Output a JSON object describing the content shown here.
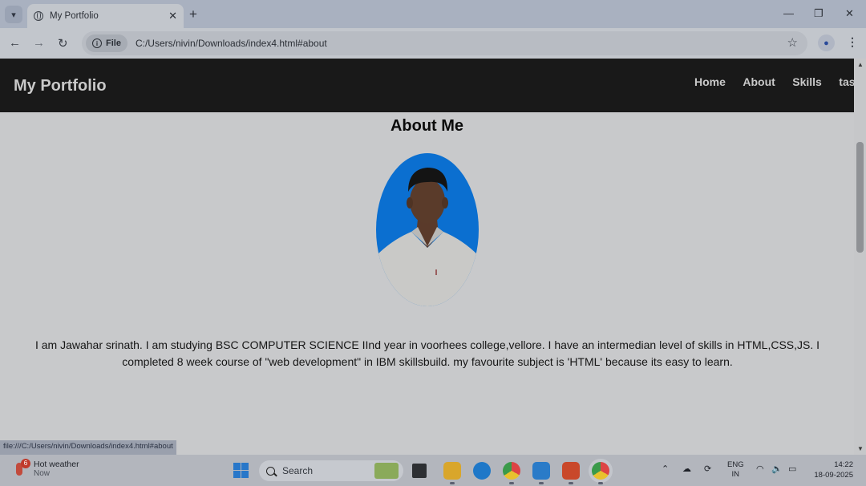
{
  "browser": {
    "tab_title": "My Portfolio",
    "new_tab": "+",
    "site_info_chip": "File",
    "url": "C:/Users/nivin/Downloads/index4.html#about",
    "status_url": "file:///C:/Users/nivin/Downloads/index4.html#about"
  },
  "site": {
    "brand": "My Portfolio",
    "nav": [
      "Home",
      "About",
      "Skills",
      "task"
    ],
    "about_heading": "About Me",
    "about_text": "I am Jawahar srinath. I am studying BSC COMPUTER SCIENCE IInd year in voorhees college,vellore. I have an intermedian level of skills in HTML,CSS,JS. I completed 8 week course of \"web development\" in IBM skillsbuild. my favourite subject is 'HTML' because its easy to learn."
  },
  "taskbar": {
    "weather_title": "Hot weather",
    "weather_sub": "Now",
    "weather_badge": "6",
    "search_label": "Search",
    "lang_top": "ENG",
    "lang_bottom": "IN",
    "time": "14:22",
    "date": "18-09-2025"
  },
  "colors": {
    "nav_bg": "#191919",
    "photo_bg": "#0b6fd0"
  }
}
